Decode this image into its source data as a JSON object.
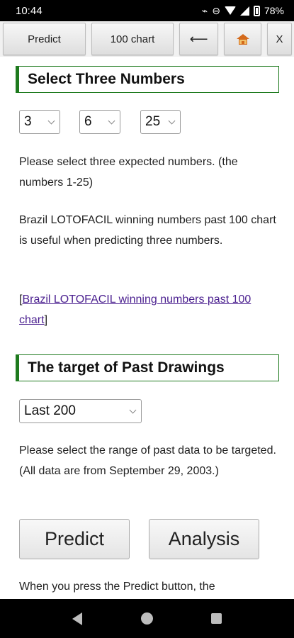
{
  "status_bar": {
    "time": "10:44",
    "battery": "78%"
  },
  "toolbar": {
    "predict_label": "Predict",
    "chart_label": "100 chart",
    "back_label": "⟵",
    "close_label": "X"
  },
  "section1": {
    "title": "Select Three Numbers",
    "selects": [
      "3",
      "6",
      "25"
    ],
    "desc": "Please select three expected numbers. (the numbers 1-25)",
    "note": "Brazil LOTOFACIL winning numbers past 100 chart is useful when predicting three numbers.",
    "link_open": "[",
    "link_text": "Brazil LOTOFACIL winning numbers past 100 chart",
    "link_close": "]"
  },
  "section2": {
    "title": "The target of Past Drawings",
    "range_select": "Last 200",
    "desc": "Please select the range of past data to be targeted. (All data are from September 29, 2003.)"
  },
  "actions": {
    "predict_label": "Predict",
    "analysis_label": "Analysis"
  },
  "footer_text": "When you press the Predict button, the"
}
